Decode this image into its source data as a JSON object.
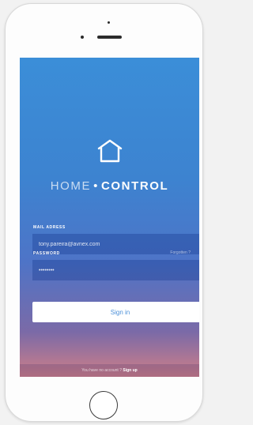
{
  "app": {
    "brand_light": "HOME",
    "brand_separator": "•",
    "brand_strong": "CONTROL"
  },
  "form": {
    "email_label": "MAIL ADRESS",
    "email_value": "tony.pareira@avnex.com",
    "password_label": "PASSWORD",
    "forgot_label": "Forgotten ?",
    "password_value": "••••••••",
    "signin_label": "Sign in"
  },
  "footer": {
    "prompt": "You have no account ?",
    "signup_label": "Sign up"
  },
  "icons": {
    "logo": "house-outline-icon",
    "home_button": "home-button-icon"
  },
  "colors": {
    "screen_gradient": [
      "#3b8ed8",
      "#3d83d0",
      "#4e74c7",
      "#7b6aa7",
      "#cf7f88"
    ],
    "signin_text": "#4a8fd8",
    "phone_body": "#fdfdfd"
  }
}
